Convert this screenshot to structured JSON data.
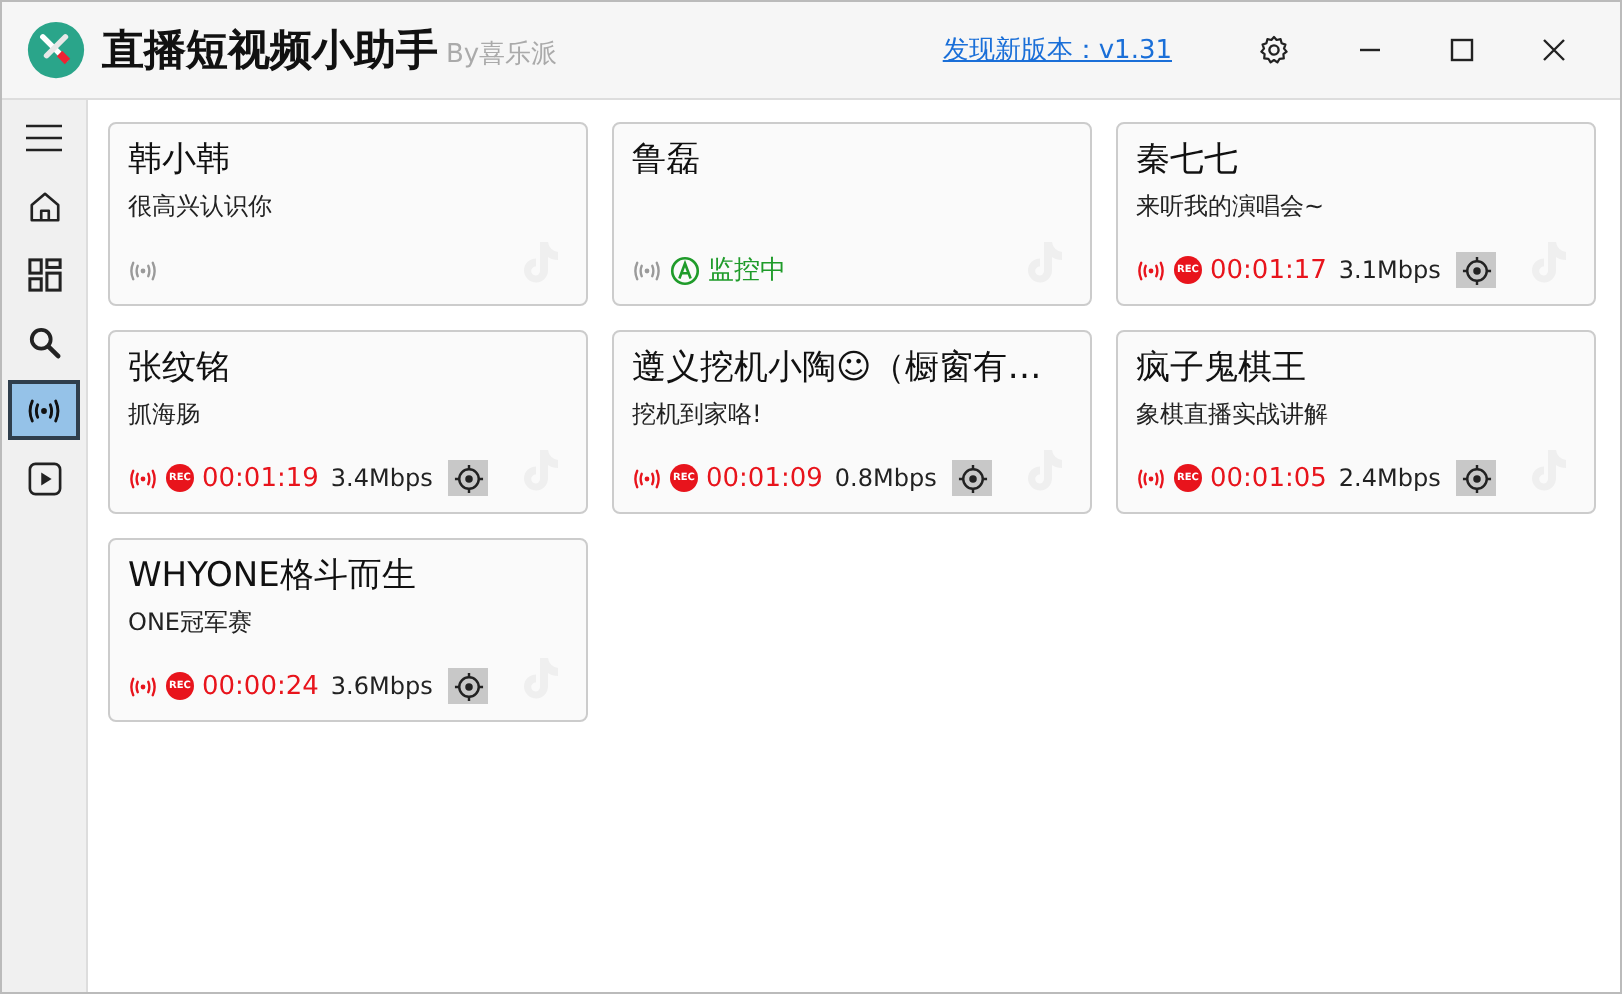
{
  "window": {
    "title": "直播短视频小助手",
    "subtitle": "By喜乐派",
    "update_link": "发现新版本：v1.31"
  },
  "sidebar": {
    "items": [
      {
        "kind": "menu",
        "selected": false
      },
      {
        "kind": "home",
        "selected": false
      },
      {
        "kind": "grid",
        "selected": false
      },
      {
        "kind": "search",
        "selected": false
      },
      {
        "kind": "live",
        "selected": true
      },
      {
        "kind": "play",
        "selected": false
      }
    ]
  },
  "streamers": [
    {
      "name": "韩小韩",
      "bio": "很高兴认识你",
      "kind": "idle"
    },
    {
      "name": "鲁磊",
      "kind": "monitoring",
      "status": "监控中"
    },
    {
      "name": "秦七七",
      "bio": "来听我的演唱会~",
      "kind": "recording",
      "badge": "REC",
      "duration": "00:01:17",
      "bitrate": "3.1Mbps"
    },
    {
      "name": "张纹铭",
      "bio": "抓海肠",
      "kind": "recording",
      "badge": "REC",
      "duration": "00:01:19",
      "bitrate": "3.4Mbps"
    },
    {
      "name": "遵义挖机小陶☺（橱窗有…",
      "bio": "挖机到家咯!",
      "kind": "recording",
      "badge": "REC",
      "duration": "00:01:09",
      "bitrate": "0.8Mbps"
    },
    {
      "name": "疯子鬼棋王",
      "bio": "象棋直播实战讲解",
      "kind": "recording",
      "badge": "REC",
      "duration": "00:01:05",
      "bitrate": "2.4Mbps"
    },
    {
      "name": "WHYONE格斗而生",
      "bio": "ONE冠军赛",
      "kind": "recording",
      "badge": "REC",
      "duration": "00:00:24",
      "bitrate": "3.6Mbps"
    }
  ]
}
